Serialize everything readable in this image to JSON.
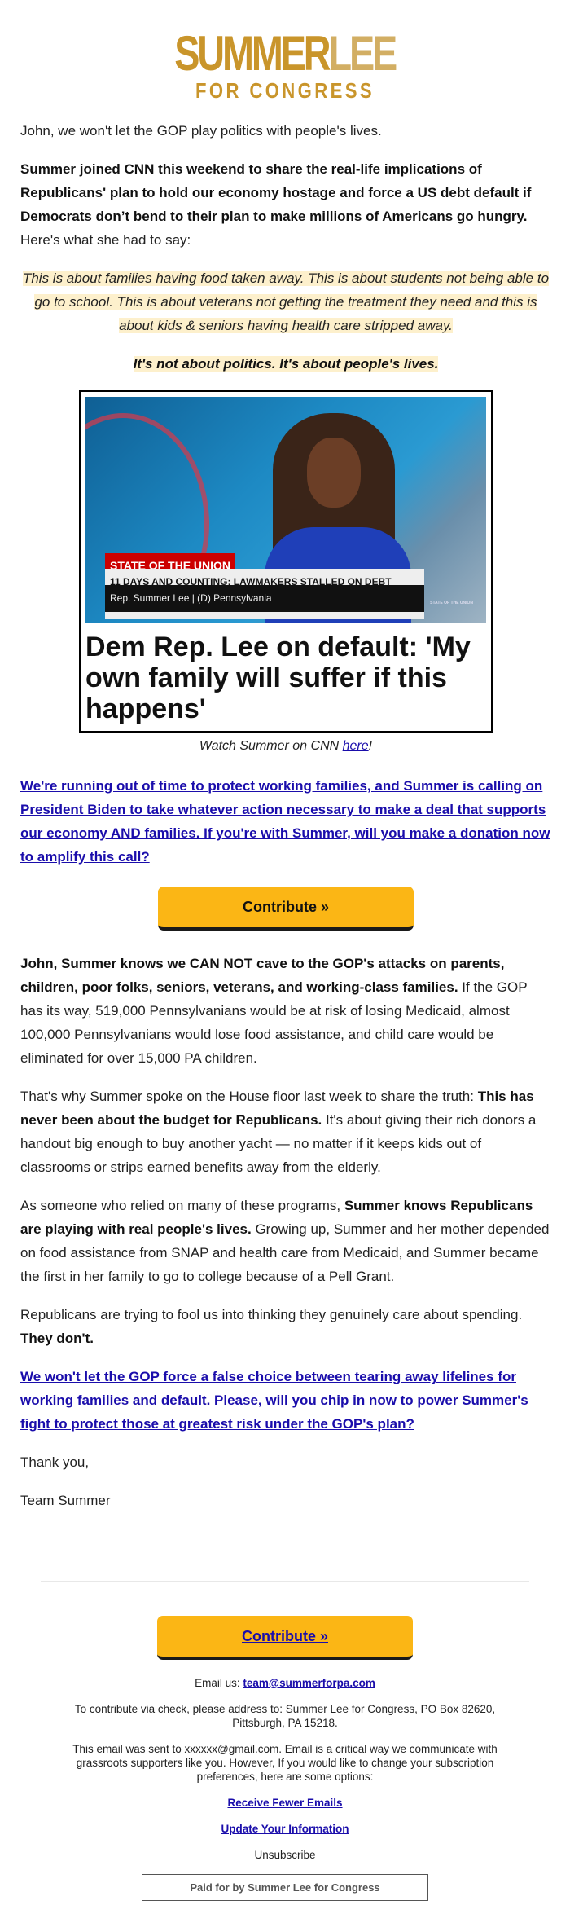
{
  "brand": {
    "logo_line1a": "SUMMER",
    "logo_line1b": "LEE",
    "logo_line2": "FOR CONGRESS",
    "accent_gold": "#C9952B",
    "button_color": "#FBB615"
  },
  "body": {
    "intro": "John, we won't let the GOP play politics with people's lives.",
    "bold_intro": "Summer joined CNN this weekend to share the real-life implications of Republicans' plan to hold our economy hostage and force a US debt default if Democrats don’t bend to their plan to make millions of Americans go hungry.",
    "intro_tail": " Here's what she had to say:",
    "quote": "This is about families having food taken away. This is about students not being able to go to school. This is about veterans not getting the treatment they need and this is about kids & seniors having health care stripped away.",
    "quote_bold": "It's not about politics. It's about people's lives.",
    "video": {
      "chyron_show": "STATE OF THE UNION",
      "chyron_headline": "11 DAYS AND COUNTING: LAWMAKERS STALLED ON DEBT CEILING TALKS",
      "chyron_name": "Rep. Summer Lee | (D) Pennsylvania",
      "watermark": "STATE OF THE UNION",
      "headline": "Dem Rep. Lee on default: 'My own family will suffer if this happens'"
    },
    "caption_pre": "Watch Summer on CNN ",
    "caption_link": "here",
    "caption_post": "!",
    "link1": "We're running out of time to protect working families, and Summer is calling on President Biden to take whatever action necessary to make a deal that supports our economy AND families. If you're with Summer, will you make a donation now to amplify this call?",
    "contribute": "Contribute »",
    "p1_bold": "John, Summer knows we CAN NOT cave to the GOP's attacks on parents, children, poor folks, seniors, veterans, and working-class families.",
    "p1_rest": " If the GOP has its way, 519,000 Pennsylvanians would be at risk of losing Medicaid, almost 100,000 Pennsylvanians would lose food assistance, and child care would be eliminated for over 15,000 PA children.",
    "p2_a": "That's why Summer spoke on the House floor last week to share the truth: ",
    "p2_bold": "This has never been about the budget for Republicans.",
    "p2_b": " It's about giving their rich donors a handout big enough to buy another yacht — no matter if it keeps kids out of classrooms or strips earned benefits away from the elderly.",
    "p3_a": "As someone who relied on many of these programs, ",
    "p3_bold": "Summer knows Republicans are playing with real people's lives.",
    "p3_b": " Growing up, Summer and her mother depended on food assistance from SNAP and health care from Medicaid, and Summer became the first in her family to go to college because of a Pell Grant.",
    "p4_a": "Republicans are trying to fool us into thinking they genuinely care about spending. ",
    "p4_bold": "They don't.",
    "link2": "We won't let the GOP force a false choice between tearing away lifelines for working families and default. Please, will you chip in now to power Summer's fight to protect those at greatest risk under the GOP's plan?",
    "signoff": "Thank you,",
    "signature": "Team Summer"
  },
  "footer": {
    "contribute": "Contribute »",
    "email_label": "Email us: ",
    "email": "team@summerforpa.com",
    "check": "To contribute via check, please address to: Summer Lee for Congress, PO Box 82620, Pittsburgh, PA 15218.",
    "sent": "This email was sent to xxxxxx@gmail.com. Email is a critical way we communicate with grassroots supporters like you. However, If you would like to change your subscription preferences, here are some options:",
    "fewer": "Receive Fewer Emails",
    "update": "Update Your Information",
    "unsubscribe": "Unsubscribe",
    "paid": "Paid for by Summer Lee for Congress"
  }
}
